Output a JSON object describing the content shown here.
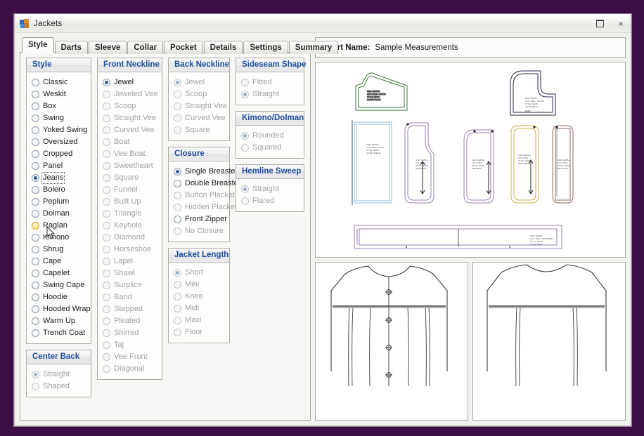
{
  "window": {
    "title": "Jackets",
    "icon": "app-icon",
    "buttons": [
      {
        "name": "restore-button",
        "glyph": "box"
      },
      {
        "name": "close-button",
        "glyph": "×"
      }
    ]
  },
  "tabs": [
    {
      "label": "Style",
      "active": true
    },
    {
      "label": "Darts",
      "active": false
    },
    {
      "label": "Sleeve",
      "active": false
    },
    {
      "label": "Collar",
      "active": false
    },
    {
      "label": "Pocket",
      "active": false
    },
    {
      "label": "Details",
      "active": false
    },
    {
      "label": "Settings",
      "active": false
    },
    {
      "label": "Summary",
      "active": false
    }
  ],
  "groups": {
    "style": {
      "title": "Style",
      "options": [
        {
          "label": "Classic",
          "checked": false,
          "disabled": false,
          "hover": false
        },
        {
          "label": "Weskit",
          "checked": false,
          "disabled": false,
          "hover": false
        },
        {
          "label": "Box",
          "checked": false,
          "disabled": false,
          "hover": false
        },
        {
          "label": "Swing",
          "checked": false,
          "disabled": false,
          "hover": false
        },
        {
          "label": "Yoked Swing",
          "checked": false,
          "disabled": false,
          "hover": false
        },
        {
          "label": "Oversized",
          "checked": false,
          "disabled": false,
          "hover": false
        },
        {
          "label": "Cropped",
          "checked": false,
          "disabled": false,
          "hover": false
        },
        {
          "label": "Panel",
          "checked": false,
          "disabled": false,
          "hover": false
        },
        {
          "label": "Jeans",
          "checked": true,
          "disabled": false,
          "hover": false,
          "focused": true
        },
        {
          "label": "Bolero",
          "checked": false,
          "disabled": false,
          "hover": false
        },
        {
          "label": "Peplum",
          "checked": false,
          "disabled": false,
          "hover": false
        },
        {
          "label": "Dolman",
          "checked": false,
          "disabled": false,
          "hover": false
        },
        {
          "label": "Raglan",
          "checked": false,
          "disabled": false,
          "hover": true
        },
        {
          "label": "Kimono",
          "checked": false,
          "disabled": false,
          "hover": false
        },
        {
          "label": "Shrug",
          "checked": false,
          "disabled": false,
          "hover": false
        },
        {
          "label": "Cape",
          "checked": false,
          "disabled": false,
          "hover": false
        },
        {
          "label": "Capelet",
          "checked": false,
          "disabled": false,
          "hover": false
        },
        {
          "label": "Swing Cape",
          "checked": false,
          "disabled": false,
          "hover": false
        },
        {
          "label": "Hoodie",
          "checked": false,
          "disabled": false,
          "hover": false
        },
        {
          "label": "Hooded Wrap",
          "checked": false,
          "disabled": false,
          "hover": false
        },
        {
          "label": "Warm Up",
          "checked": false,
          "disabled": false,
          "hover": false
        },
        {
          "label": "Trench Coat",
          "checked": false,
          "disabled": false,
          "hover": false
        }
      ]
    },
    "center_back": {
      "title": "Center Back",
      "options": [
        {
          "label": "Straight",
          "checked": true,
          "disabled": true
        },
        {
          "label": "Shaped",
          "checked": false,
          "disabled": true
        }
      ]
    },
    "front_neckline": {
      "title": "Front Neckline",
      "options": [
        {
          "label": "Jewel",
          "checked": true,
          "disabled": false
        },
        {
          "label": "Jeweled Vee",
          "checked": false,
          "disabled": true
        },
        {
          "label": "Scoop",
          "checked": false,
          "disabled": true
        },
        {
          "label": "Straight Vee",
          "checked": false,
          "disabled": true
        },
        {
          "label": "Curved Vee",
          "checked": false,
          "disabled": true
        },
        {
          "label": "Boat",
          "checked": false,
          "disabled": true
        },
        {
          "label": "Vee Boat",
          "checked": false,
          "disabled": true
        },
        {
          "label": "Sweetheart",
          "checked": false,
          "disabled": true
        },
        {
          "label": "Square",
          "checked": false,
          "disabled": true
        },
        {
          "label": "Funnel",
          "checked": false,
          "disabled": true
        },
        {
          "label": "Built Up",
          "checked": false,
          "disabled": true
        },
        {
          "label": "Triangle",
          "checked": false,
          "disabled": true
        },
        {
          "label": "Keyhole",
          "checked": false,
          "disabled": true
        },
        {
          "label": "Diamond",
          "checked": false,
          "disabled": true
        },
        {
          "label": "Horseshoe",
          "checked": false,
          "disabled": true
        },
        {
          "label": "Lapel",
          "checked": false,
          "disabled": true
        },
        {
          "label": "Shawl",
          "checked": false,
          "disabled": true
        },
        {
          "label": "Surplice",
          "checked": false,
          "disabled": true
        },
        {
          "label": "Band",
          "checked": false,
          "disabled": true
        },
        {
          "label": "Stepped",
          "checked": false,
          "disabled": true
        },
        {
          "label": "Pleated",
          "checked": false,
          "disabled": true
        },
        {
          "label": "Shirred",
          "checked": false,
          "disabled": true
        },
        {
          "label": "Taj",
          "checked": false,
          "disabled": true
        },
        {
          "label": "Vee Front",
          "checked": false,
          "disabled": true
        },
        {
          "label": "Diagonal",
          "checked": false,
          "disabled": true
        }
      ]
    },
    "back_neckline": {
      "title": "Back Neckline",
      "options": [
        {
          "label": "Jewel",
          "checked": true,
          "disabled": true
        },
        {
          "label": "Scoop",
          "checked": false,
          "disabled": true
        },
        {
          "label": "Straight Vee",
          "checked": false,
          "disabled": true
        },
        {
          "label": "Curved Vee",
          "checked": false,
          "disabled": true
        },
        {
          "label": "Square",
          "checked": false,
          "disabled": true
        }
      ]
    },
    "closure": {
      "title": "Closure",
      "options": [
        {
          "label": "Single Breasted",
          "checked": true,
          "disabled": false
        },
        {
          "label": "Double Breasted",
          "checked": false,
          "disabled": false
        },
        {
          "label": "Button Placket",
          "checked": false,
          "disabled": true
        },
        {
          "label": "Hidden Placket",
          "checked": false,
          "disabled": true
        },
        {
          "label": "Front Zipper",
          "checked": false,
          "disabled": false
        },
        {
          "label": "No Closure",
          "checked": false,
          "disabled": true
        }
      ]
    },
    "jacket_length": {
      "title": "Jacket Length",
      "options": [
        {
          "label": "Short",
          "checked": true,
          "disabled": true
        },
        {
          "label": "Mini",
          "checked": false,
          "disabled": true
        },
        {
          "label": "Knee",
          "checked": false,
          "disabled": true
        },
        {
          "label": "Midi",
          "checked": false,
          "disabled": true
        },
        {
          "label": "Maxi",
          "checked": false,
          "disabled": true
        },
        {
          "label": "Floor",
          "checked": false,
          "disabled": true
        }
      ]
    },
    "sideseam_shape": {
      "title": "Sideseam Shape",
      "options": [
        {
          "label": "Fitted",
          "checked": false,
          "disabled": true
        },
        {
          "label": "Straight",
          "checked": true,
          "disabled": true
        }
      ]
    },
    "kimono_dolman": {
      "title": "Kimono/Dolman",
      "options": [
        {
          "label": "Rounded",
          "checked": true,
          "disabled": true
        },
        {
          "label": "Squared",
          "checked": false,
          "disabled": true
        }
      ]
    },
    "hemline_sweep": {
      "title": "Hemline Sweep",
      "options": [
        {
          "label": "Straight",
          "checked": true,
          "disabled": true
        },
        {
          "label": "Flared",
          "checked": false,
          "disabled": true
        }
      ]
    }
  },
  "chart": {
    "name_label": "Chart Name:",
    "name_value": "Sample Measurements"
  },
  "preview": {
    "pattern_piece_colors": [
      "#3d7a3d",
      "#2a2a52",
      "#8fbcd8",
      "#9a7fbe",
      "#c9b44a",
      "#8a6a5c",
      "#9a7fbe"
    ],
    "front_view_name": "front-garment-view",
    "back_view_name": "back-garment-view"
  },
  "colors": {
    "desktop": "#3c0d46",
    "group_header_text": "#1f4e9c",
    "radio_checked": "#2b5f96",
    "radio_hover": "#f8d277"
  }
}
